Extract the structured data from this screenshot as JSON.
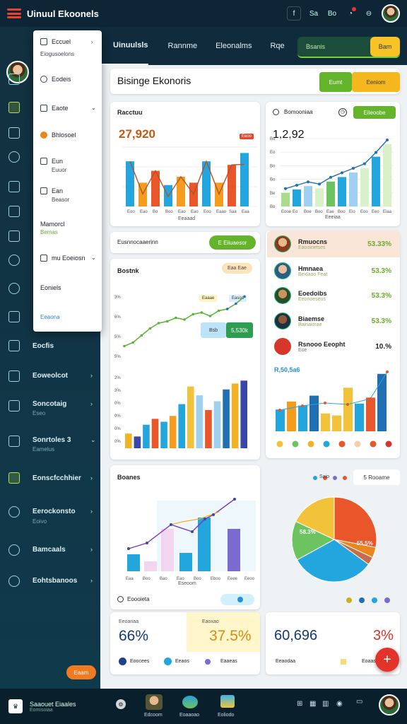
{
  "app": {
    "title": "Uinuul Ekoonels"
  },
  "topbar": {
    "icons": [
      "f",
      "Sa",
      "Bo"
    ]
  },
  "sidebar": {
    "items": [
      {
        "label": "Eocfis",
        "sub": "",
        "icon": "box-icon"
      },
      {
        "label": "Eoweolcot",
        "sub": "",
        "icon": "document-icon"
      },
      {
        "label": "Soncotaig",
        "sub": "Eseo",
        "icon": "chart-icon"
      },
      {
        "label": "Sonrtoles 3",
        "sub": "Eamelus",
        "icon": "monitor-icon"
      },
      {
        "label": "Eonscfcchhier",
        "sub": "",
        "icon": "chart-icon"
      },
      {
        "label": "Eerockonsto",
        "sub": "Eoivo",
        "icon": "globe-icon"
      },
      {
        "label": "Bamcaals",
        "sub": "",
        "icon": "globe-icon"
      },
      {
        "label": "Eohtsbanoos",
        "sub": "",
        "icon": "compass-icon"
      }
    ],
    "button_label": "Eaam"
  },
  "dropdown": {
    "items": [
      {
        "label": "Eccuel",
        "sub": "Eiogusoelons"
      },
      {
        "label": "Eodeis"
      },
      {
        "label": "Eaote"
      },
      {
        "label": "Bhlosoel"
      },
      {
        "label": "Eun",
        "sub": "Euuor"
      },
      {
        "label": "Ean",
        "sub": "Beasor"
      },
      {
        "label": "Mamorcl",
        "sub": "Bemas"
      },
      {
        "label": "mu Eoeiosn"
      },
      {
        "label": "Eoniels"
      },
      {
        "label": "Eeaona"
      }
    ]
  },
  "tabs": [
    {
      "label": "Uinuulsls",
      "active": true
    },
    {
      "label": "Rannme"
    },
    {
      "label": "Eleonalms"
    },
    {
      "label": "Rqe"
    }
  ],
  "tab_cta": {
    "label": "Bsanis",
    "pill": "Bam"
  },
  "page": {
    "title": "Bisinge Ekonoris",
    "btn_green": "Eumt",
    "btn_yellow": "Eeniom"
  },
  "card1": {
    "title": "Racctuu",
    "value": "27,920",
    "badge": "Eeoo",
    "xlabel": "Eeaaad"
  },
  "card2": {
    "title": "Bomooniaa",
    "value": "1,2,92",
    "btn": "Eileoobe",
    "xlabel": "Eeeiaa"
  },
  "bar_row": {
    "label": "Eusnnocaaerinn",
    "btn": "E Eiiuaesor"
  },
  "card3": {
    "title": "Bostnk",
    "badge": "Eaa Eae",
    "tag1": "Eaaae",
    "tag2": "Easoa",
    "callout_label": "Bsb",
    "callout_value": "5,530k"
  },
  "people": [
    {
      "name": "Rmuocns",
      "sub": "Eaooinetses",
      "value": "53.33%"
    },
    {
      "name": "Hmnaea",
      "sub": "Bexlaoo Feat",
      "value": "53.3%"
    },
    {
      "name": "Eoedoibs",
      "sub": "Eeonoeseus",
      "value": "53.3%"
    },
    {
      "name": "Biaemse",
      "sub": "Bainaiorae",
      "value": "53.3%"
    },
    {
      "name": "Rsnooo Eeopht",
      "sub": "Eoe",
      "value": "10.%"
    }
  ],
  "card4": {
    "value": "R,50,5a6"
  },
  "card5": {
    "title": "Boanes",
    "footer": "Eoooieta",
    "xlabel": "Eseoom"
  },
  "pie_card": {
    "legend": [
      "Saio",
      "Eais"
    ],
    "filter": "5 Rooame",
    "labels": [
      "58.3%",
      "55.5%"
    ]
  },
  "kpis": [
    {
      "label": "Eeoanaa",
      "value": "66%"
    },
    {
      "label": "Eaoxao",
      "value": "37.5%"
    },
    {
      "label": "",
      "value": "60,696"
    },
    {
      "label": "",
      "value": "3%"
    }
  ],
  "kpi_legend": [
    "Eoocees",
    "Eeaos",
    "Eaaeas"
  ],
  "kpi_legend2": [
    "Eeaodaa",
    "Eoaas"
  ],
  "bottom": {
    "app_label": "Saaouet Eiaales",
    "app_sub": "Eomisoiaa",
    "items": [
      "Edcoom",
      "Eoaaoao",
      "Eoliodo"
    ]
  },
  "chart_data": [
    {
      "type": "bar",
      "title": "Racctuu",
      "categories": [
        "Eoo",
        "Eao",
        "Bo",
        "Boo",
        "Eao",
        "Eao",
        "Eoo",
        "Eaao",
        "Saa",
        "Eaa"
      ],
      "series": [
        {
          "values": [
            38,
            20,
            30,
            18,
            25,
            20,
            38,
            20,
            35,
            45
          ]
        }
      ]
    },
    {
      "type": "bar",
      "title": "Bomooniaa",
      "categories": [
        "Eooe",
        "Eo",
        "Boe",
        "Boo",
        "Eae",
        "Boo",
        "Eio",
        "Eoo",
        "Eeo",
        "Eiaa"
      ],
      "series": [
        {
          "values": [
            12,
            15,
            18,
            16,
            22,
            26,
            30,
            34,
            44,
            55
          ]
        }
      ]
    },
    {
      "type": "line",
      "title": "Bostnk",
      "series": [
        {
          "values": [
            5,
            7,
            11,
            15,
            18,
            19,
            21,
            20,
            23,
            24,
            22,
            25,
            26,
            29,
            33
          ]
        }
      ],
      "y_ticks": [
        "3%",
        "6%",
        "5%",
        "5%"
      ]
    },
    {
      "type": "bar",
      "title": "Boanes",
      "categories": [
        "Eaa",
        "Boo",
        "Bao",
        "Eao",
        "Boo",
        "Eboo",
        "Eeee",
        "Eeoo"
      ],
      "series": [
        {
          "values": [
            10,
            6,
            12,
            28,
            8,
            30,
            32,
            20
          ]
        }
      ],
      "y_ticks": [
        "2%",
        "3%",
        "0%",
        "0%",
        "0%",
        "0%"
      ]
    },
    {
      "type": "pie",
      "values": [
        28,
        32,
        15,
        18,
        4,
        3
      ],
      "labels": [
        "58.3%",
        "55.5%"
      ]
    }
  ]
}
